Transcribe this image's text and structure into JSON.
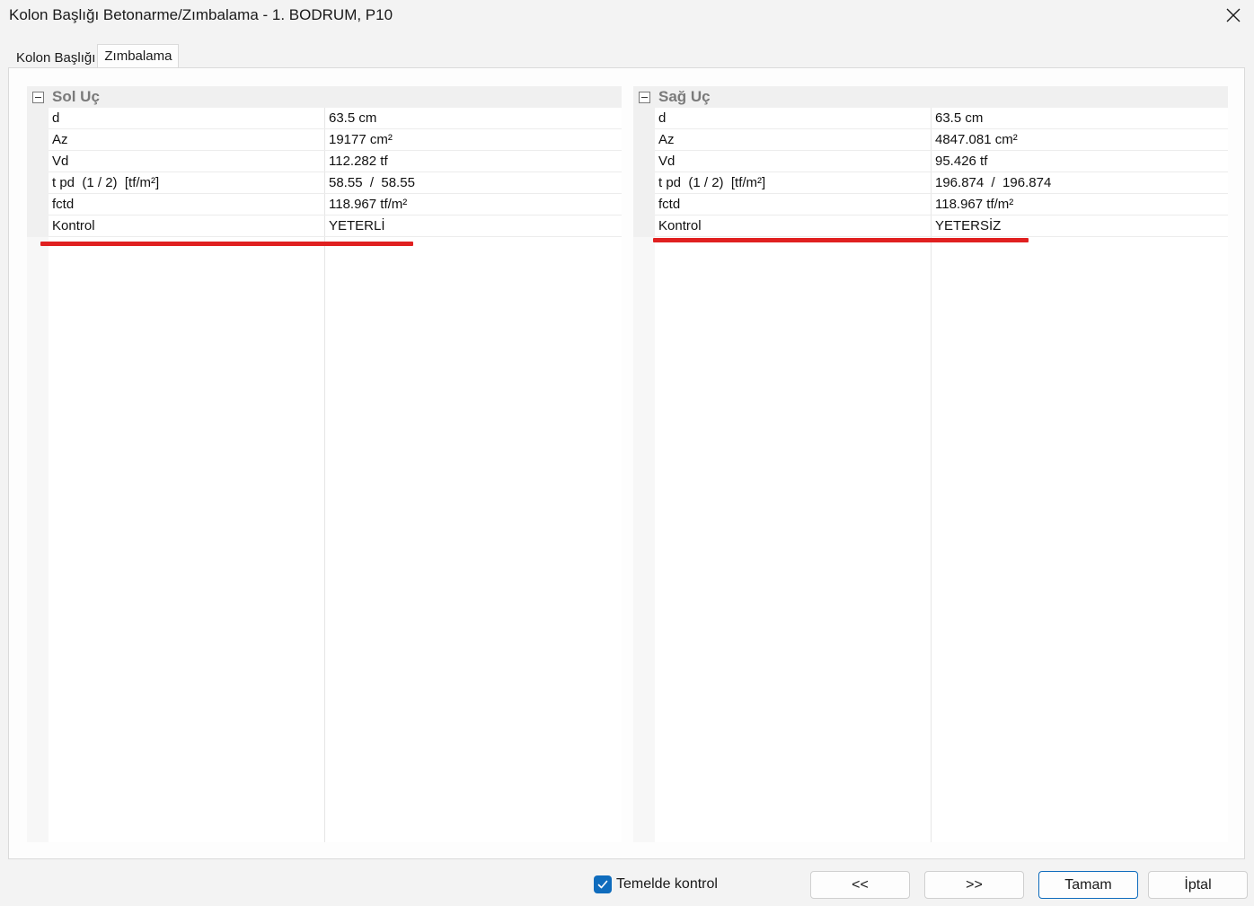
{
  "window": {
    "title": "Kolon Başlığı Betonarme/Zımbalama - 1. BODRUM, P10"
  },
  "tabs": [
    {
      "label": "Kolon Başlığı"
    },
    {
      "label": "Zımbalama"
    }
  ],
  "left_panel": {
    "category": "Sol Uç",
    "rows": [
      {
        "name": "d",
        "value": "63.5 cm"
      },
      {
        "name": "Az",
        "value": "19177 cm²"
      },
      {
        "name": "Vd",
        "value": "112.282 tf"
      },
      {
        "name": "t pd  (1 / 2)  [tf/m²]",
        "value": "58.55  /  58.55"
      },
      {
        "name": "fctd",
        "value": "118.967 tf/m²"
      },
      {
        "name": "Kontrol",
        "value": "YETERLİ"
      }
    ]
  },
  "right_panel": {
    "category": "Sağ Uç",
    "rows": [
      {
        "name": "d",
        "value": "63.5 cm"
      },
      {
        "name": "Az",
        "value": "4847.081 cm²"
      },
      {
        "name": "Vd",
        "value": "95.426 tf"
      },
      {
        "name": "t pd  (1 / 2)  [tf/m²]",
        "value": "196.874  /  196.874"
      },
      {
        "name": "fctd",
        "value": "118.967 tf/m²"
      },
      {
        "name": "Kontrol",
        "value": "YETERSİZ"
      }
    ]
  },
  "footer": {
    "checkbox_label": "Temelde kontrol",
    "checkbox_checked": true,
    "prev_label": "<<",
    "next_label": ">>",
    "ok_label": "Tamam",
    "cancel_label": "İptal"
  },
  "colors": {
    "highlight_underline": "#e02020",
    "accent": "#0f6cbd"
  }
}
